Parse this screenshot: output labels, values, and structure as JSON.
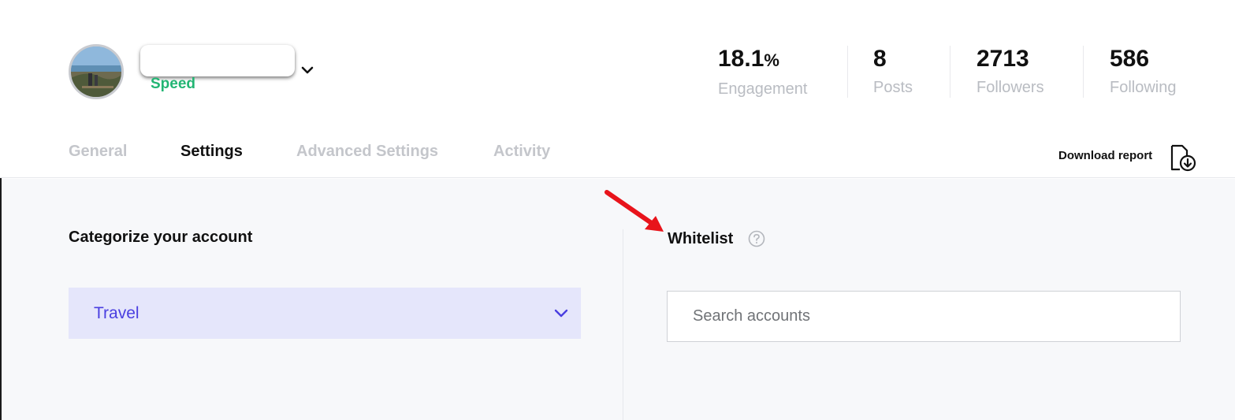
{
  "account": {
    "subtitle": "Speed"
  },
  "stats": [
    {
      "value": "18.1",
      "suffix": "%",
      "label": "Engagement"
    },
    {
      "value": "8",
      "suffix": "",
      "label": "Posts"
    },
    {
      "value": "2713",
      "suffix": "",
      "label": "Followers"
    },
    {
      "value": "586",
      "suffix": "",
      "label": "Following"
    }
  ],
  "tabs": [
    {
      "label": "General",
      "active": false
    },
    {
      "label": "Settings",
      "active": true
    },
    {
      "label": "Advanced Settings",
      "active": false
    },
    {
      "label": "Activity",
      "active": false
    }
  ],
  "download": {
    "label": "Download report"
  },
  "categorize": {
    "title": "Categorize your account",
    "selected": "Travel"
  },
  "whitelist": {
    "title": "Whitelist",
    "search_placeholder": "Search accounts"
  },
  "colors": {
    "accent_green": "#22b573",
    "select_bg": "#e5e6fb",
    "select_text": "#4a3fe0",
    "annotation_arrow": "#e8141b"
  },
  "icons": {
    "account_dropdown": "chevron-down-icon",
    "category_dropdown": "chevron-down-icon",
    "download": "file-download-icon",
    "help": "question-circle-icon",
    "annotation": "red-arrow-icon"
  }
}
